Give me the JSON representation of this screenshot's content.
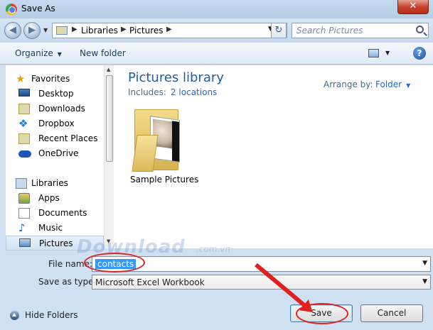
{
  "window": {
    "title": "Save As",
    "close_glyph": "✕"
  },
  "navigation": {
    "back_glyph": "◀",
    "forward_glyph": "▶",
    "address_parts": [
      "Libraries",
      "Pictures"
    ],
    "address_sep": "▶",
    "refresh_glyph": "↻",
    "search_placeholder": "Search Pictures"
  },
  "toolbar": {
    "organize": "Organize",
    "new_folder": "New folder",
    "help_glyph": "?"
  },
  "sidebar": {
    "items": [
      {
        "label": "Favorites",
        "icon": "star-icon"
      },
      {
        "label": "Desktop",
        "icon": "desktop-icon"
      },
      {
        "label": "Downloads",
        "icon": "downloads-icon"
      },
      {
        "label": "Dropbox",
        "icon": "dropbox-icon"
      },
      {
        "label": "Recent Places",
        "icon": "recent-places-icon"
      },
      {
        "label": "OneDrive",
        "icon": "onedrive-icon"
      },
      {
        "label": "Libraries",
        "icon": "libraries-icon"
      },
      {
        "label": "Apps",
        "icon": "apps-icon"
      },
      {
        "label": "Documents",
        "icon": "documents-icon"
      },
      {
        "label": "Music",
        "icon": "music-icon"
      },
      {
        "label": "Pictures",
        "icon": "pictures-icon",
        "selected": true
      }
    ]
  },
  "content": {
    "library_title": "Pictures library",
    "includes_label": "Includes:",
    "includes_link": "2 locations",
    "arrange_label": "Arrange by:",
    "arrange_value": "Folder",
    "items": [
      {
        "label": "Sample Pictures",
        "icon": "sample-pictures-folder-icon"
      }
    ]
  },
  "form": {
    "file_name_label": "File name:",
    "file_name_value": "contacts",
    "save_type_label": "Save as type:",
    "save_type_value": "Microsoft Excel Workbook"
  },
  "footer": {
    "hide_folders": "Hide Folders",
    "save_button": "Save",
    "cancel_button": "Cancel"
  },
  "watermark": {
    "text": "Download",
    "suffix": ".com.vn"
  },
  "colors": {
    "accent": "#1c6ad6",
    "annotation": "#e0201f"
  }
}
